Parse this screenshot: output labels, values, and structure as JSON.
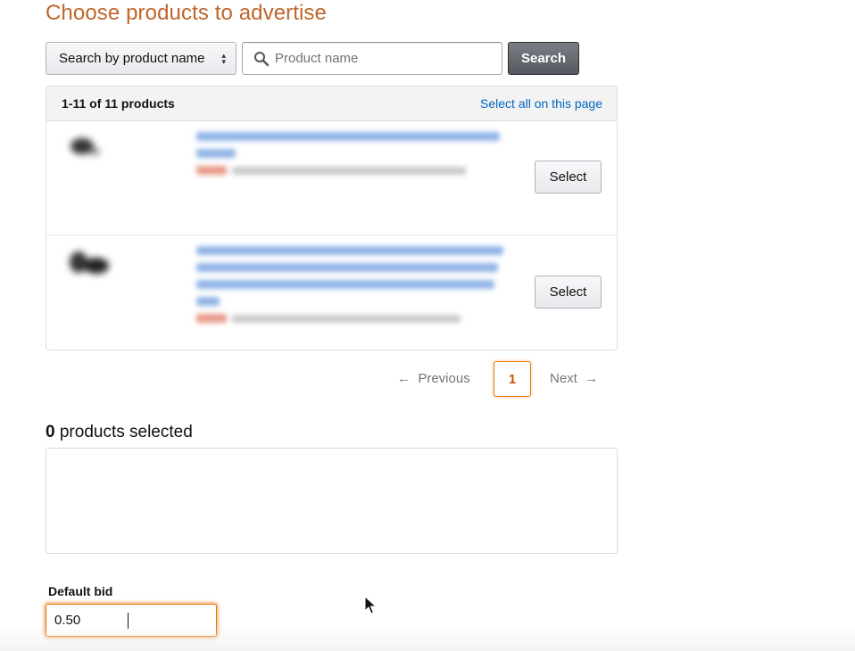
{
  "page": {
    "title": "Choose products to advertise"
  },
  "search": {
    "mode_label": "Search by product name",
    "placeholder": "Product name",
    "value": "",
    "button_label": "Search"
  },
  "results": {
    "count_label": "1-11 of 11 products",
    "select_all_label": "Select all on this page",
    "items": [
      {
        "select_label": "Select"
      },
      {
        "select_label": "Select"
      }
    ]
  },
  "pagination": {
    "previous_label": "Previous",
    "current_page": "1",
    "next_label": "Next"
  },
  "selection": {
    "count": "0",
    "label": "products selected"
  },
  "bid": {
    "label": "Default bid",
    "value": "0.50"
  },
  "colors": {
    "title": "#c0652a",
    "link": "#0066c0",
    "focus": "#e77600"
  },
  "icons": {
    "search": "magnifier-icon",
    "select_arrows": "updown-arrows-icon",
    "prev": "arrow-left-icon",
    "next": "arrow-right-icon",
    "cursor": "mouse-pointer-icon"
  }
}
